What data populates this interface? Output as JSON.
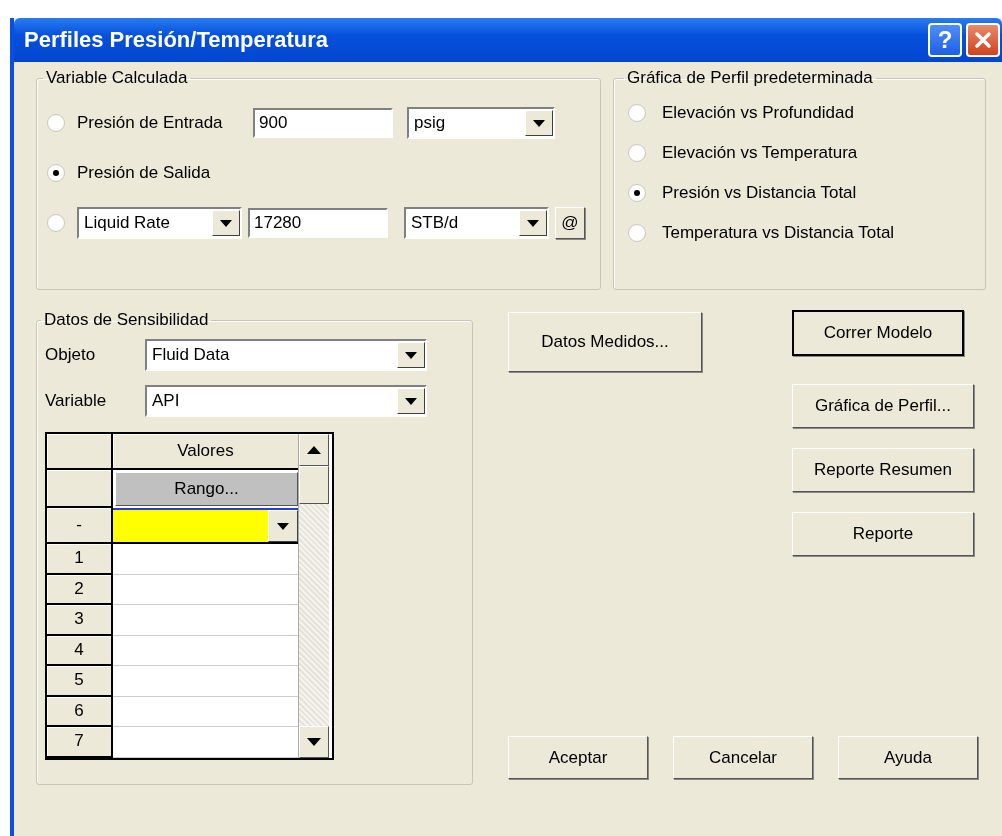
{
  "window": {
    "title": "Perfiles Presión/Temperatura",
    "help": "?"
  },
  "variable_calculada": {
    "title": "Variable Calculada",
    "options": [
      {
        "kind": "input",
        "label": "Presión de Entrada",
        "selected": false,
        "value": "900",
        "unit": "psig"
      },
      {
        "kind": "plain",
        "label": "Presión de Salida",
        "selected": true
      },
      {
        "kind": "rate",
        "selected": false,
        "rate_type": "Liquid Rate",
        "value": "17280",
        "unit": "STB/d",
        "button": "@"
      }
    ]
  },
  "grafica_perfil": {
    "title": "Gráfica de Perfil predeterminada",
    "options": [
      {
        "label": "Elevación vs Profundidad",
        "selected": false
      },
      {
        "label": "Elevación vs Temperatura",
        "selected": false
      },
      {
        "label": "Presión vs Distancia Total",
        "selected": true
      },
      {
        "label": "Temperatura vs Distancia Total",
        "selected": false
      }
    ]
  },
  "sensibilidad": {
    "title": "Datos de Sensibilidad",
    "fields": [
      {
        "label": "Objeto",
        "value": "Fluid Data"
      },
      {
        "label": "Variable",
        "value": "API"
      }
    ],
    "grid": {
      "column": "Valores",
      "range_button": "Rango...",
      "edit_row": "-",
      "rows": [
        "1",
        "2",
        "3",
        "4",
        "5",
        "6",
        "7"
      ]
    }
  },
  "side_button": "Datos Medidos...",
  "right_buttons": [
    {
      "label": "Correr Modelo",
      "default": true
    },
    {
      "label": "Gráfica de Perfil...",
      "default": false
    },
    {
      "label": "Reporte Resumen",
      "default": false
    },
    {
      "label": "Reporte",
      "default": false
    }
  ],
  "bottom_buttons": [
    "Aceptar",
    "Cancelar",
    "Ayuda"
  ]
}
